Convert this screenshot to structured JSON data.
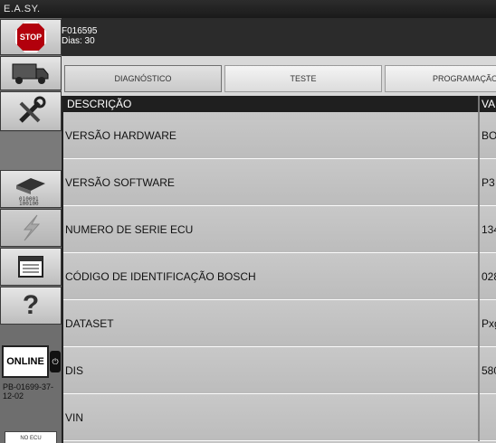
{
  "app": {
    "title": "E.A.SY."
  },
  "sidebar": {
    "stop_label": "STOP",
    "online_label": "ONLINE",
    "usb_symbol": "⏻",
    "ecu_code": "PB-01699-37-12-02",
    "noecu_label": "NO ECU",
    "icons": [
      "stop-icon",
      "truck-icon",
      "tools-icon",
      "ecu-chip-icon",
      "flash-icon",
      "report-icon",
      "help-icon"
    ]
  },
  "header": {
    "id": "F016595",
    "days": "Dias: 30"
  },
  "tabs": [
    {
      "label": "DIAGNÓSTICO",
      "active": true
    },
    {
      "label": "TESTE",
      "active": false
    },
    {
      "label": "PROGRAMAÇÃO",
      "active": false
    }
  ],
  "table": {
    "columns": [
      "DESCRIÇÃO",
      "VA"
    ],
    "rows": [
      {
        "desc": "VERSÃO HARDWARE",
        "value": "BO"
      },
      {
        "desc": "VERSÃO SOFTWARE",
        "value": "P3"
      },
      {
        "desc": "NUMERO DE SERIE ECU",
        "value": "134"
      },
      {
        "desc": "CÓDIGO DE IDENTIFICAÇÃO BOSCH",
        "value": "028"
      },
      {
        "desc": "DATASET",
        "value": "Pxg"
      },
      {
        "desc": "DIS",
        "value": "580"
      },
      {
        "desc": "VIN",
        "value": ""
      }
    ]
  },
  "colors": {
    "stop_red": "#b2000c",
    "header_bg": "#2b2b2b",
    "row_bg": "#c4c4c4"
  }
}
